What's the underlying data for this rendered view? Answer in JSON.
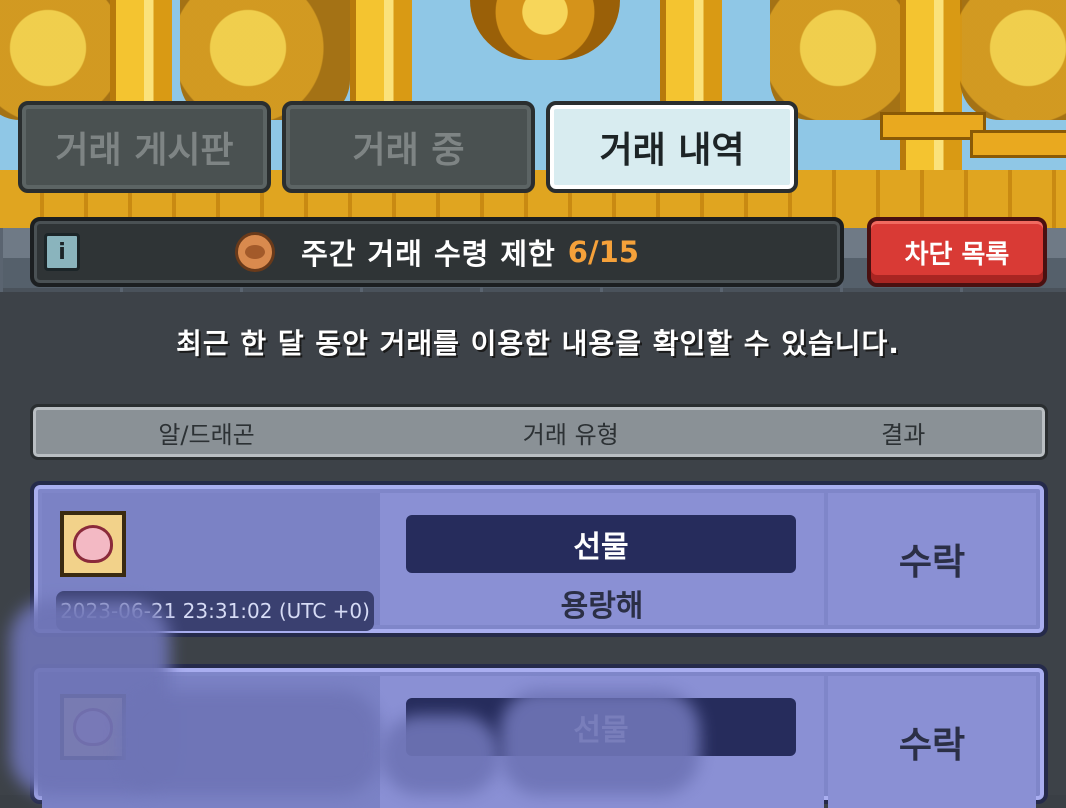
{
  "tabs": [
    {
      "label": "거래 게시판",
      "active": false
    },
    {
      "label": "거래 중",
      "active": false
    },
    {
      "label": "거래 내역",
      "active": true
    }
  ],
  "limit_bar": {
    "info_icon": "i",
    "icon": "dragon-coin-icon",
    "label": "주간 거래 수령 제한",
    "count": "6/15",
    "count_color": "#f5a13a"
  },
  "block_button": {
    "label": "차단 목록",
    "color": "#d93a35"
  },
  "notice": "최근 한 달 동안 거래를 이용한 내용을 확인할 수 있습니다.",
  "table": {
    "headers": [
      "알/드래곤",
      "거래 유형",
      "결과"
    ],
    "rows": [
      {
        "icon": "dragon-egg-icon",
        "date": "2023-06-21 23:31:02 (UTC +0)",
        "type": "선물",
        "dragon": "용랑해",
        "result": "수락"
      },
      {
        "icon": "dragon-egg-icon",
        "date": "",
        "type": "선물",
        "dragon": "",
        "result": "수락"
      }
    ]
  }
}
